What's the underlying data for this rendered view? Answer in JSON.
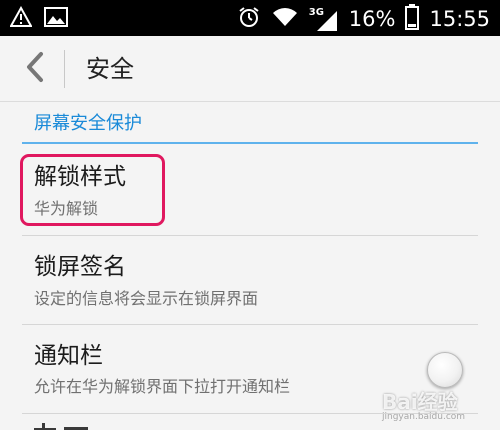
{
  "status_bar": {
    "network_label": "3G",
    "battery_percent": "16%",
    "time": "15:55",
    "icons": [
      "warning-icon",
      "gallery-icon",
      "alarm-icon",
      "wifi-icon",
      "signal-icon",
      "battery-icon"
    ]
  },
  "action_bar": {
    "title": "安全",
    "back_icon": "chevron-left-icon"
  },
  "section": {
    "header": "屏幕安全保护",
    "accent_color": "#1a8ad8"
  },
  "items": [
    {
      "title": "解锁样式",
      "summary": "华为解锁"
    },
    {
      "title": "锁屏签名",
      "summary": "设定的信息将会显示在锁屏界面"
    },
    {
      "title": "通知栏",
      "summary": "允许在华为解锁界面下拉打开通知栏",
      "toggle_on": false
    }
  ],
  "highlight_color": "#e0185f",
  "watermark": {
    "logo": "Bai经验",
    "url": "jingyan.baidu.com"
  }
}
